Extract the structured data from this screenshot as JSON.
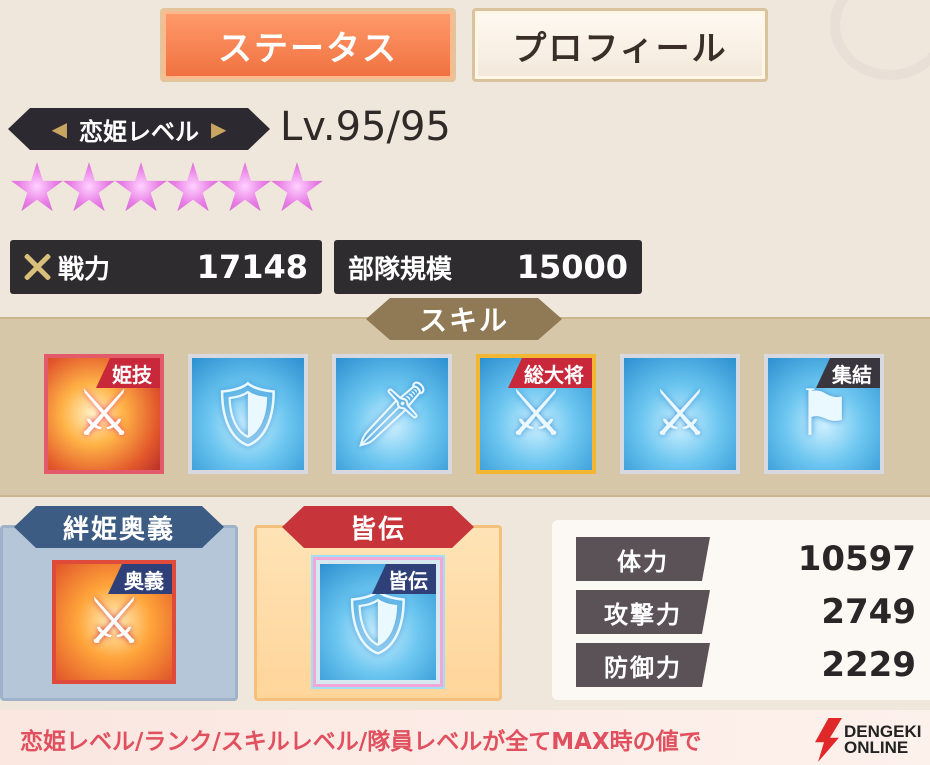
{
  "tabs": {
    "status": "ステータス",
    "profile": "プロフィール"
  },
  "level": {
    "label": "恋姫レベル",
    "value": "Lv.95/95"
  },
  "rarity_stars": 6,
  "combat": {
    "power_label": "戦力",
    "power_value": "17148",
    "troops_label": "部隊規模",
    "troops_value": "15000"
  },
  "skills": {
    "title": "スキル",
    "items": [
      {
        "tag": "姫技"
      },
      {
        "tag": ""
      },
      {
        "tag": ""
      },
      {
        "tag": "総大将"
      },
      {
        "tag": ""
      },
      {
        "tag": "集結"
      }
    ]
  },
  "kizuna": {
    "title": "絆姫奥義",
    "tag": "奥義"
  },
  "kaiden": {
    "title": "皆伝",
    "tag": "皆伝"
  },
  "stats": [
    {
      "label": "体力",
      "value": "10597"
    },
    {
      "label": "攻撃力",
      "value": "2749"
    },
    {
      "label": "防御力",
      "value": "2229"
    }
  ],
  "footer": {
    "note": "恋姫レベル/ランク/スキルレベル/隊員レベルが全てMAX時の値で",
    "logo_line1": "DENGEKI",
    "logo_line2": "ONLINE"
  }
}
